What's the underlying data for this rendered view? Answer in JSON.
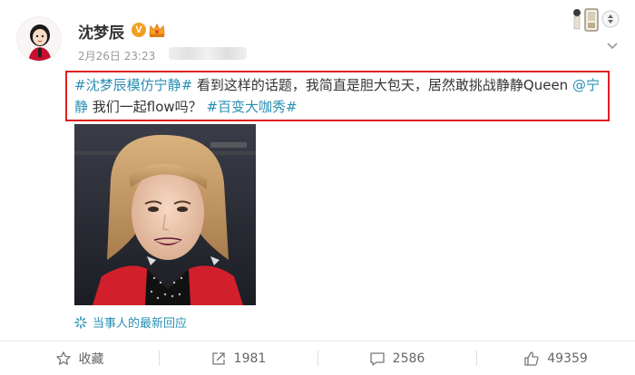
{
  "user": {
    "name": "沈梦辰",
    "verified_badge": "V",
    "date": "2月26日 23:23"
  },
  "post": {
    "topic1": "#沈梦辰模仿宁静#",
    "text1": " 看到这样的话题，我简直是胆大包天，居然敢挑战静静Queen ",
    "mention": "@宁静",
    "text2": " 我们一起flow吗？ ",
    "topic2": "#百变大咖秀#"
  },
  "reply_link": "当事人的最新回应",
  "actions": {
    "favorite_label": "收藏",
    "repost_count": "1981",
    "comment_count": "2586",
    "like_count": "49359"
  },
  "icons": {
    "favorite": "star-icon",
    "repost": "share-icon",
    "comment": "comment-icon",
    "like": "thumbs-up-icon",
    "reply": "sparkle-icon",
    "more": "chevron-down-icon"
  },
  "colors": {
    "link": "#2a8fb5",
    "highlight_box": "#e02020",
    "badge": "#f0a020"
  }
}
